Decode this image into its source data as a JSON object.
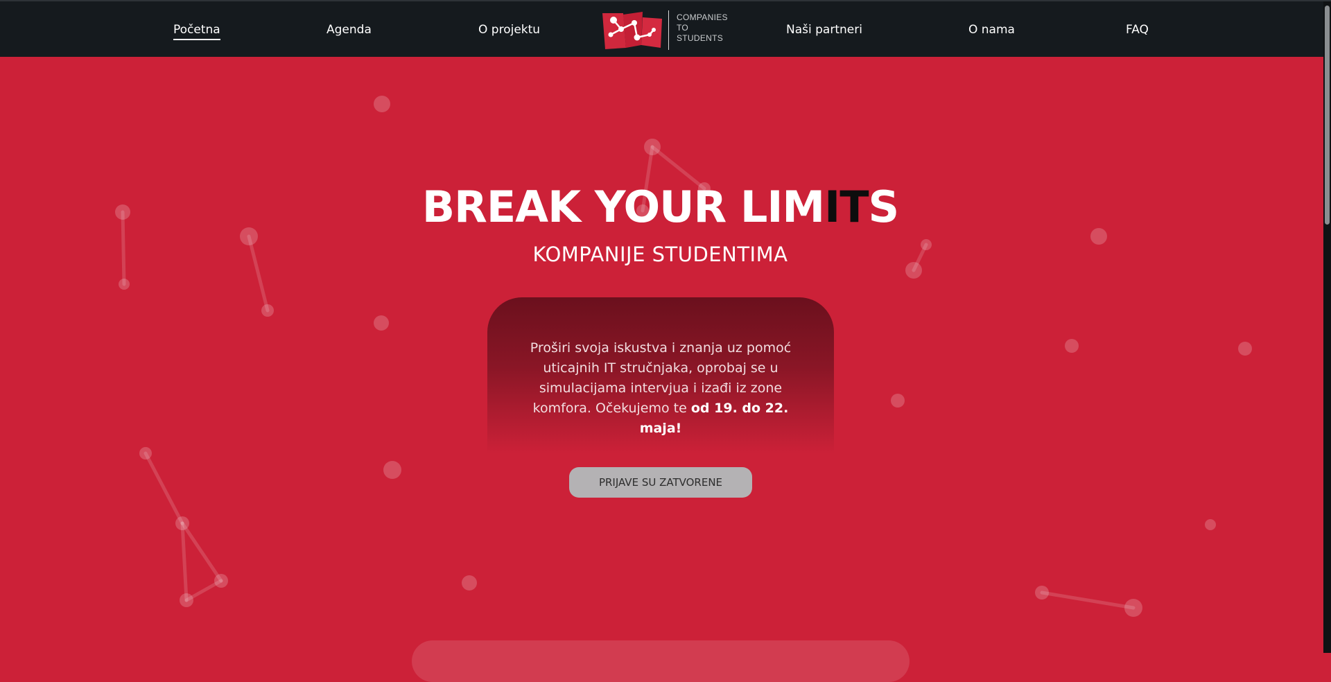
{
  "nav": {
    "items_left": [
      "Početna",
      "Agenda",
      "O projektu"
    ],
    "items_right": [
      "Naši partneri",
      "O nama",
      "FAQ"
    ],
    "active": "Početna"
  },
  "logo": {
    "lines": [
      "COMPANIES",
      "TO",
      "STUDENTS"
    ]
  },
  "hero": {
    "title_light": "BREAK YOUR LIM",
    "title_dark": "IT",
    "title_end": "S",
    "subtitle": "KOMPANIJE STUDENTIMA"
  },
  "info": {
    "text_prefix": "Proširi svoja iskustva i znanja uz pomoć uticajnih IT stručnjaka, oprobaj se u simulacijama intervjua i izađi iz zone komfora. Očekujemo te ",
    "text_bold": "od 19. do 22. maja!"
  },
  "cta": {
    "label": "PRIJAVE SU ZATVORENE"
  },
  "colors": {
    "background": "#cc2138",
    "navbar": "#151a1e",
    "card": "#6b101d",
    "button": "#b4b2b4"
  }
}
